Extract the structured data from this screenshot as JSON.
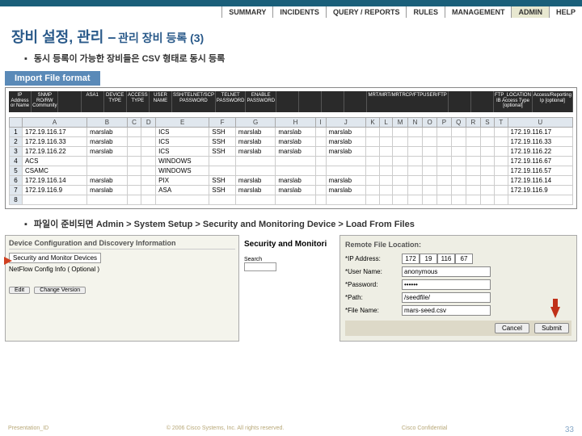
{
  "topnav": {
    "items": [
      "SUMMARY",
      "INCIDENTS",
      "QUERY / REPORTS",
      "RULES",
      "MANAGEMENT",
      "ADMIN",
      "HELP"
    ]
  },
  "title": {
    "main": "장비 설정, 관리 –",
    "sub": "관리 장비 등록 (3)"
  },
  "bullet1": "동시 등록이 가능한 장비들은 CSV 형태로 동시 등록",
  "section1": "Import File format",
  "import_headers": [
    "IP Address or Name",
    "SNMP RO/RW Community",
    "",
    "ASA1",
    "DEVICE TYPE",
    "ACCESS TYPE",
    "USER NAME",
    "SSH/TELNET/SCP PASSWORD",
    "TELNET PASSWORD",
    "ENABLE PASSWORD",
    "",
    "",
    "",
    "",
    "MRT/MRT/MRTRCP/FTPUSER/FTP",
    "",
    "",
    "FTP_LOCATION IB Access Type [optional]",
    "Access/Reporting Ip [optional]"
  ],
  "csv_cols": [
    "",
    "A",
    "B",
    "C",
    "D",
    "E",
    "F",
    "G",
    "H",
    "I",
    "J",
    "K",
    "L",
    "M",
    "N",
    "O",
    "P",
    "Q",
    "R",
    "S",
    "T",
    "U"
  ],
  "csv_rows": [
    {
      "n": "1",
      "A": "172.19.116.17",
      "B": "marslab",
      "E": "ICS",
      "F": "SSH",
      "G": "marslab",
      "H": "marslab",
      "J": "marslab",
      "U": "172.19.116.17"
    },
    {
      "n": "2",
      "A": "172.19.116.33",
      "B": "marslab",
      "E": "ICS",
      "F": "SSH",
      "G": "marslab",
      "H": "marslab",
      "J": "marslab",
      "U": "172.19.116.33"
    },
    {
      "n": "3",
      "A": "172.19.116.22",
      "B": "marslab",
      "E": "ICS",
      "F": "SSH",
      "G": "marslab",
      "H": "marslab",
      "J": "marslab",
      "U": "172.19.116.22"
    },
    {
      "n": "4",
      "A": "ACS",
      "E": "WINDOWS",
      "U": "172.19.116.67"
    },
    {
      "n": "5",
      "A": "CSAMC",
      "E": "WINDOWS",
      "U": "172.19.116.57"
    },
    {
      "n": "6",
      "A": "172.19.116.14",
      "B": "marslab",
      "E": "PIX",
      "F": "SSH",
      "G": "marslab",
      "H": "marslab",
      "J": "marslab",
      "U": "172.19.116.14"
    },
    {
      "n": "7",
      "A": "172.19.116.9",
      "B": "marslab",
      "E": "ASA",
      "F": "SSH",
      "G": "marslab",
      "H": "marslab",
      "J": "marslab",
      "U": "172.19.116.9"
    },
    {
      "n": "8"
    }
  ],
  "bullet2": "파일이 준비되면 Admin > System Setup > Security and Monitoring Device > Load From Files",
  "left_panel": {
    "hdr": "Device Configuration and Discovery Information",
    "item1": "Security and Monitor Devices",
    "item2": "NetFlow Config Info ( Optional )",
    "btn_edit": "Edit",
    "btn_change": "Change Version"
  },
  "mid_panel": {
    "title": "Security and Monitori",
    "search": "Search"
  },
  "right_panel": {
    "hdr": "Remote File Location:",
    "ip_label": "*IP Address:",
    "ip": [
      "172",
      "19",
      "116",
      "67"
    ],
    "user_label": "*User Name:",
    "user_val": "anonymous",
    "pass_label": "*Password:",
    "pass_val": "••••••",
    "path_label": "*Path:",
    "path_val": "/seedfile/",
    "file_label": "*File Name:",
    "file_val": "mars-seed.csv",
    "btn_cancel": "Cancel",
    "btn_submit": "Submit"
  },
  "footer": {
    "left": "Presentation_ID",
    "mid1": "© 2006 Cisco Systems, Inc. All rights reserved.",
    "mid2": "Cisco Confidential",
    "page": "33"
  }
}
